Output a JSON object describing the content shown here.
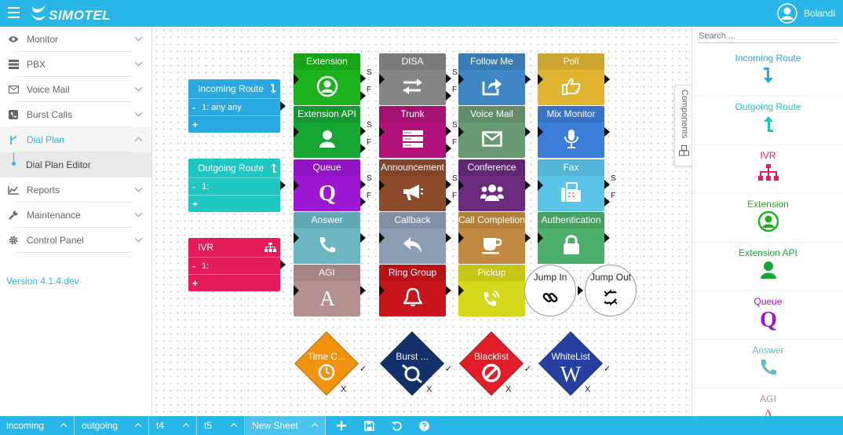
{
  "app": {
    "brand": "SIMOTEL",
    "user": "Bolandi",
    "brand_color": "#29b6e8"
  },
  "sidebar": {
    "items": [
      {
        "label": "Monitor",
        "icon": "eye-icon"
      },
      {
        "label": "PBX",
        "icon": "server-icon"
      },
      {
        "label": "Voice Mail",
        "icon": "envelope-icon"
      },
      {
        "label": "Burst Calls",
        "icon": "phone-square-icon"
      },
      {
        "label": "Dial Plan",
        "icon": "branch-icon",
        "active": true
      },
      {
        "label": "Reports",
        "icon": "chart-icon"
      },
      {
        "label": "Maintenance",
        "icon": "wrench-icon"
      },
      {
        "label": "Control Panel",
        "icon": "gear-icon"
      }
    ],
    "sub_item": "Dial Plan Editor",
    "version": "Version 4.1.4.dev"
  },
  "routes": {
    "incoming": {
      "title": "Incoming Route",
      "row1": "1: any any",
      "minus": "-",
      "plus": "+"
    },
    "outgoing": {
      "title": "Outgoing Route",
      "row1": "1:",
      "minus": "-",
      "plus": "+"
    },
    "ivr": {
      "title": "IVR",
      "row1": "1:",
      "minus": "-",
      "plus": "+"
    }
  },
  "tiles": [
    {
      "label": "Extension",
      "color": "#1bb21b",
      "icon": "user-circle-icon",
      "sf": true
    },
    {
      "label": "DISA",
      "color": "#858585",
      "icon": "exchange-icon",
      "sf": true
    },
    {
      "label": "Follow Me",
      "color": "#3f86c4",
      "icon": "share-icon"
    },
    {
      "label": "Poll",
      "color": "#e0b531",
      "icon": "thumbs-up-icon"
    },
    {
      "label": "Extension API",
      "color": "#17a534",
      "icon": "user-icon",
      "sf": true
    },
    {
      "label": "Trunk",
      "color": "#b0127a",
      "icon": "server-icon",
      "sf": true
    },
    {
      "label": "Voice Mail",
      "color": "#6a9a73",
      "icon": "envelope-icon"
    },
    {
      "label": "Mix Monitor",
      "color": "#3b7dd8",
      "icon": "microphone-icon"
    },
    {
      "label": "Queue",
      "color": "#9d16d2",
      "icon": "queue-icon",
      "sf": true
    },
    {
      "label": "Announcement",
      "color": "#8c4a2d",
      "icon": "bullhorn-icon",
      "sf": true
    },
    {
      "label": "Conference",
      "color": "#6a2b7d",
      "icon": "users-icon"
    },
    {
      "label": "Fax",
      "color": "#5bc5e8",
      "icon": "fax-icon",
      "sf": true
    },
    {
      "label": "Answer",
      "color": "#6ab7c2",
      "icon": "phone-icon"
    },
    {
      "label": "Callback",
      "color": "#8b9cb5",
      "icon": "reply-icon"
    },
    {
      "label": "Call Completion",
      "color": "#c28a43",
      "icon": "coffee-icon"
    },
    {
      "label": "Authentication",
      "color": "#4caf6b",
      "icon": "lock-icon"
    },
    {
      "label": "AGI",
      "color": "#b38f8f",
      "icon": "agi-icon"
    },
    {
      "label": "Ring Group",
      "color": "#c8141b",
      "icon": "bell-icon"
    },
    {
      "label": "Pickup",
      "color": "#d6d61a",
      "icon": "volume-phone-icon"
    }
  ],
  "sf_labels": {
    "s": "S",
    "f": "F"
  },
  "circles": [
    {
      "label": "Jump In",
      "icon": "link-icon"
    },
    {
      "label": "Jump Out",
      "icon": "unlink-icon"
    }
  ],
  "diamonds": [
    {
      "label": "Time C...",
      "color": "#f2930d",
      "icon": "clock-icon"
    },
    {
      "label": "Burst ...",
      "color": "#14306a",
      "icon": "burst-icon"
    },
    {
      "label": "Blacklist",
      "color": "#e21d27",
      "icon": "ban-icon"
    },
    {
      "label": "WhiteList",
      "color": "#263fa1",
      "icon": "wikipedia-icon"
    }
  ],
  "diamond_marks": {
    "check": "✓",
    "cross": "X"
  },
  "components": {
    "search_placeholder": "Search ...",
    "tab_label": "Components",
    "items": [
      {
        "label": "Incoming Route",
        "color": "#29a9e0",
        "icon": "arrow-down-icon"
      },
      {
        "label": "Outgoing Route",
        "color": "#1ec8c0",
        "icon": "arrow-up-icon"
      },
      {
        "label": "IVR",
        "color": "#e21d5a",
        "icon": "sitemap-icon"
      },
      {
        "label": "Extension",
        "color": "#1bb21b",
        "icon": "user-circle-icon"
      },
      {
        "label": "Extension API",
        "color": "#17a534",
        "icon": "user-icon"
      },
      {
        "label": "Queue",
        "color": "#9d16d2",
        "icon": "queue-icon"
      },
      {
        "label": "Answer",
        "color": "#6ab7c2",
        "icon": "phone-icon"
      },
      {
        "label": "AGI",
        "color": "#b38f8f",
        "icon": "agi-icon"
      }
    ]
  },
  "bottom": {
    "tabs": [
      "incoming",
      "outgoing",
      "t4",
      "t5",
      "New Sheet"
    ]
  }
}
